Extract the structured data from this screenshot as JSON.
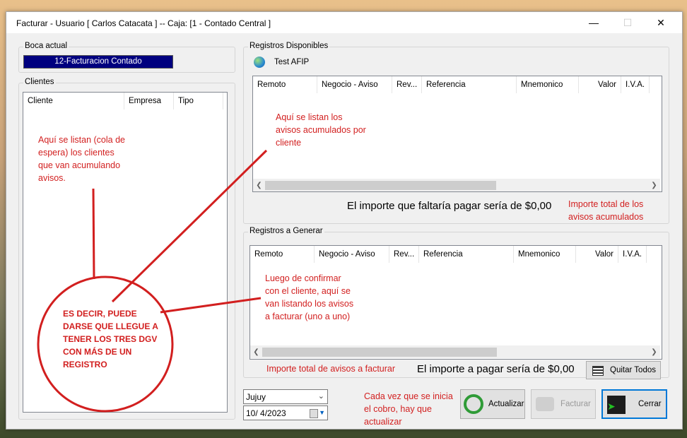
{
  "window": {
    "title": "Facturar - Usuario [ Carlos Catacata ]  --  Caja: [1 - Contado Central ]",
    "minimize_glyph": "—",
    "maximize_glyph": "☐",
    "close_glyph": "✕"
  },
  "boca": {
    "group_label": "Boca actual",
    "value": "12-Facturacion Contado"
  },
  "clientes": {
    "group_label": "Clientes",
    "columns": [
      "Cliente",
      "Empresa",
      "Tipo"
    ]
  },
  "registros_disponibles": {
    "group_label": "Registros Disponibles",
    "afip_label": "Test AFIP",
    "columns": [
      "Remoto",
      "Negocio - Aviso",
      "Rev...",
      "Referencia",
      "Mnemonico",
      "Valor",
      "I.V.A."
    ],
    "total_text": "El importe que faltaría pagar sería de $0,00"
  },
  "registros_generar": {
    "group_label": "Registros a Generar",
    "columns": [
      "Remoto",
      "Negocio - Aviso",
      "Rev...",
      "Referencia",
      "Mnemonico",
      "Valor",
      "I.V.A."
    ],
    "total_text": "El importe a pagar sería de $0,00",
    "quitar_label": "Quitar Todos"
  },
  "bottom": {
    "province": "Jujuy",
    "date": "10/  4/2023",
    "actualizar_label": "Actualizar",
    "facturar_label": "Facturar",
    "cerrar_label": "Cerrar"
  },
  "annotations": {
    "clientes_note": [
      "Aquí se listan (cola de",
      "espera) los clientes",
      "que van acumulando",
      "avisos."
    ],
    "disponibles_note": [
      "Aquí se listan los",
      "avisos acumulados por",
      "cliente"
    ],
    "importe_total_note": [
      "Importe total de los",
      "avisos acumulados"
    ],
    "generar_note": [
      "Luego de confirmar",
      "con el cliente, aquí se",
      "van listando los avisos",
      "a facturar (uno a uno)"
    ],
    "importe_facturar_note": "Importe total de avisos a facturar",
    "actualizar_note": [
      "Cada vez que se inicia",
      "el cobro, hay que",
      "actualizar"
    ],
    "circle_note": [
      "ES DECIR, PUEDE",
      "DARSE QUE LLEGUE A",
      "TENER LOS TRES DGV",
      "CON MÁS DE UN",
      "REGISTRO"
    ]
  },
  "colors": {
    "annotation_red": "#d21f1f",
    "boca_blue": "#00007f"
  }
}
